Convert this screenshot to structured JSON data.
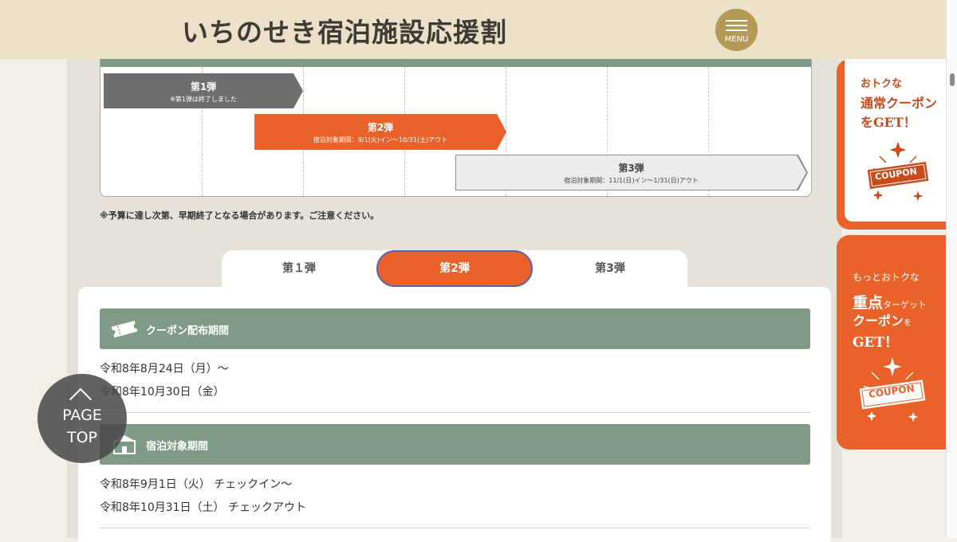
{
  "header": {
    "title": "いちのせき宿泊施設応援割",
    "menu_label": "MENU"
  },
  "schedule": {
    "phase1": {
      "title": "第1弾",
      "note": "※第1弾は終了しました"
    },
    "phase2": {
      "title": "第2弾",
      "note": "宿泊対象期間：9/1(火)イン〜10/31(土)アウト"
    },
    "phase3": {
      "title": "第3弾",
      "note": "宿泊対象期間：11/1(日)イン〜1/31(日)アウト"
    },
    "budget_note": "※予算に達し次第、早期終了となる場合があります。ご注意ください。"
  },
  "tabs": [
    {
      "label": "第１弾",
      "active": false
    },
    {
      "label": "第2弾",
      "active": true
    },
    {
      "label": "第3弾",
      "active": false
    }
  ],
  "sections": {
    "coupon_period": {
      "heading": "クーポン配布期間",
      "icon": "ticket-icon",
      "lines": [
        "令和8年8月24日（月）〜",
        "令和8年10月30日（金）"
      ]
    },
    "stay_period": {
      "heading": "宿泊対象期間",
      "icon": "hotel-icon",
      "lines": [
        "令和8年9月1日（火） チェックイン〜",
        "令和8年10月31日（土） チェックアウト"
      ]
    }
  },
  "page_top": {
    "line1": "PAGE",
    "line2": "TOP"
  },
  "banners": {
    "regular": {
      "line1": "おトクな",
      "line2": "通常クーポン",
      "line3": "をGET！",
      "badge": "COUPON"
    },
    "priority": {
      "line1": "もっとおトクな",
      "line2": "重点",
      "line2_small": "ターゲット",
      "line3": "クーポン",
      "line3_small": "を",
      "line4": "GET！",
      "badge": "COUPON"
    }
  },
  "colors": {
    "accent_orange": "#e8622a",
    "section_green": "#7f9a85",
    "header_beige": "#ece0c8",
    "menu_gold": "#b29a55"
  }
}
